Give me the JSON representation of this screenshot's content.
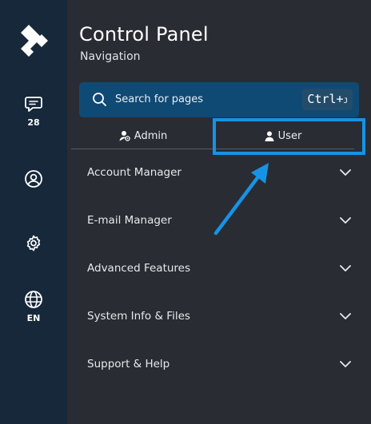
{
  "rail": {
    "chat_count": "28",
    "language": "EN"
  },
  "header": {
    "title": "Control Panel",
    "subtitle": "Navigation"
  },
  "search": {
    "placeholder": "Search for pages",
    "shortcut": "Ctrl+",
    "shortcut_key": "J"
  },
  "tabs": {
    "admin_label": "Admin",
    "user_label": "User"
  },
  "menu": {
    "items": [
      {
        "label": "Account Manager"
      },
      {
        "label": "E-mail Manager"
      },
      {
        "label": "Advanced Features"
      },
      {
        "label": "System Info & Files"
      },
      {
        "label": "Support & Help"
      }
    ]
  },
  "colors": {
    "rail_bg": "#16283a",
    "panel_bg": "#2a2c33",
    "search_bg": "#0f4a74",
    "highlight": "#1593e6"
  }
}
